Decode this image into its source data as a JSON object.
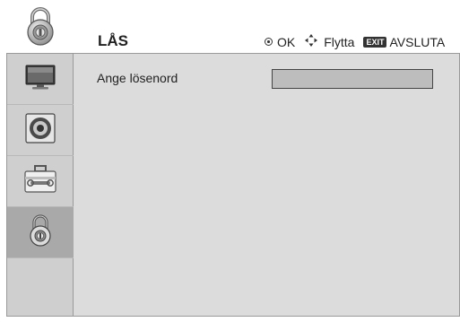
{
  "header": {
    "title": "LÅS",
    "icon": "padlock-icon"
  },
  "help_bar": {
    "ok_label": "OK",
    "move_label": "Flytta",
    "exit_badge": "EXIT",
    "exit_label": "AVSLUTA"
  },
  "sidebar": {
    "items": [
      {
        "icon": "tv-picture-icon",
        "active": false
      },
      {
        "icon": "speaker-audio-icon",
        "active": false
      },
      {
        "icon": "toolbox-settings-icon",
        "active": false
      },
      {
        "icon": "padlock-icon",
        "active": true
      }
    ]
  },
  "main": {
    "password_label": "Ange lösenord",
    "password_value": ""
  },
  "colors": {
    "panel_bg": "#dcdcdc",
    "sidebar_bg": "#cfcfcf",
    "active_item_bg": "#a9a9a9",
    "input_bg": "#bdbdbd"
  }
}
